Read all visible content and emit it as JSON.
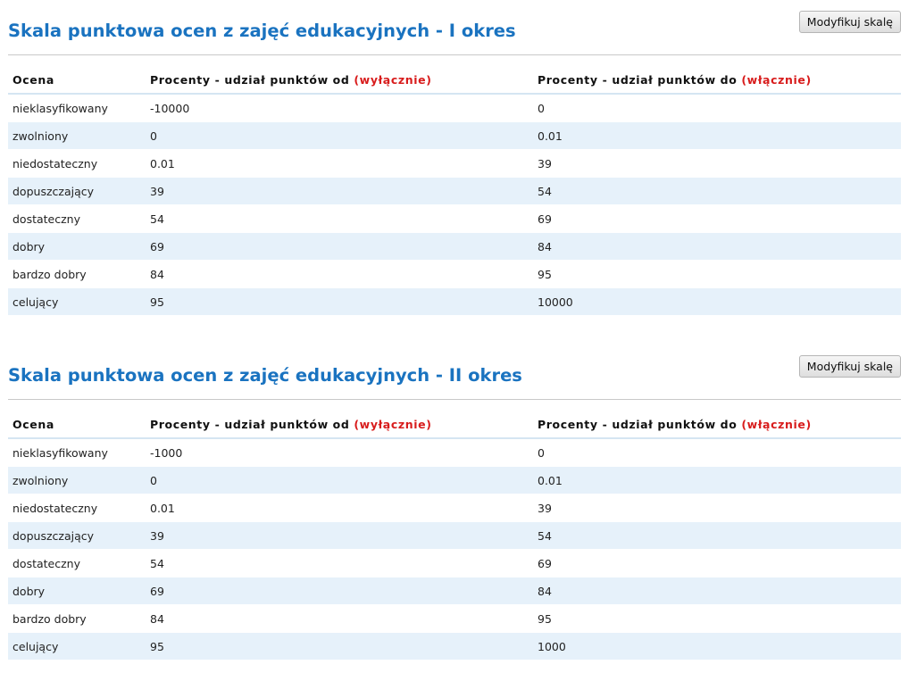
{
  "sections": [
    {
      "title": "Skala punktowa ocen z zajęć edukacyjnych - I okres",
      "button_label": "Modyfikuj skalę",
      "headers": {
        "grade": "Ocena",
        "from": "Procenty - udział punktów od",
        "from_note": "(wyłącznie)",
        "to": "Procenty - udział punktów do",
        "to_note": "(włącznie)"
      },
      "rows": [
        {
          "grade": "nieklasyfikowany",
          "from": "-10000",
          "to": "0"
        },
        {
          "grade": "zwolniony",
          "from": "0",
          "to": "0.01"
        },
        {
          "grade": "niedostateczny",
          "from": "0.01",
          "to": "39"
        },
        {
          "grade": "dopuszczający",
          "from": "39",
          "to": "54"
        },
        {
          "grade": "dostateczny",
          "from": "54",
          "to": "69"
        },
        {
          "grade": "dobry",
          "from": "69",
          "to": "84"
        },
        {
          "grade": "bardzo dobry",
          "from": "84",
          "to": "95"
        },
        {
          "grade": "celujący",
          "from": "95",
          "to": "10000"
        }
      ]
    },
    {
      "title": "Skala punktowa ocen z zajęć edukacyjnych - II okres",
      "button_label": "Modyfikuj skalę",
      "headers": {
        "grade": "Ocena",
        "from": "Procenty - udział punktów od",
        "from_note": "(wyłącznie)",
        "to": "Procenty - udział punktów do",
        "to_note": "(włącznie)"
      },
      "rows": [
        {
          "grade": "nieklasyfikowany",
          "from": "-1000",
          "to": "0"
        },
        {
          "grade": "zwolniony",
          "from": "0",
          "to": "0.01"
        },
        {
          "grade": "niedostateczny",
          "from": "0.01",
          "to": "39"
        },
        {
          "grade": "dopuszczający",
          "from": "39",
          "to": "54"
        },
        {
          "grade": "dostateczny",
          "from": "54",
          "to": "69"
        },
        {
          "grade": "dobry",
          "from": "69",
          "to": "84"
        },
        {
          "grade": "bardzo dobry",
          "from": "84",
          "to": "95"
        },
        {
          "grade": "celujący",
          "from": "95",
          "to": "1000"
        }
      ]
    }
  ],
  "colors": {
    "title": "#1a73c0",
    "note": "#d81c1c",
    "row_alt": "#e6f1fa"
  }
}
